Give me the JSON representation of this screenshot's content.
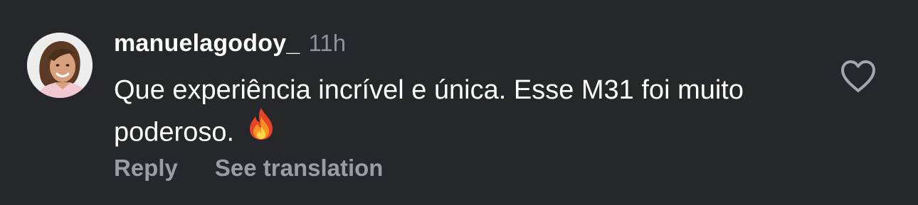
{
  "comment": {
    "username": "manuelagodoy_",
    "time": "11h",
    "text": "Que experiência incrível e única. Esse M31 foi muito poderoso.",
    "emoji": "fire-emoji"
  },
  "actions": {
    "reply_label": "Reply",
    "translate_label": "See translation"
  },
  "icons": {
    "like": "heart-icon"
  },
  "colors": {
    "background": "#25272B",
    "primary_text": "#FFFFFF",
    "secondary_text": "#9A9DA2"
  }
}
